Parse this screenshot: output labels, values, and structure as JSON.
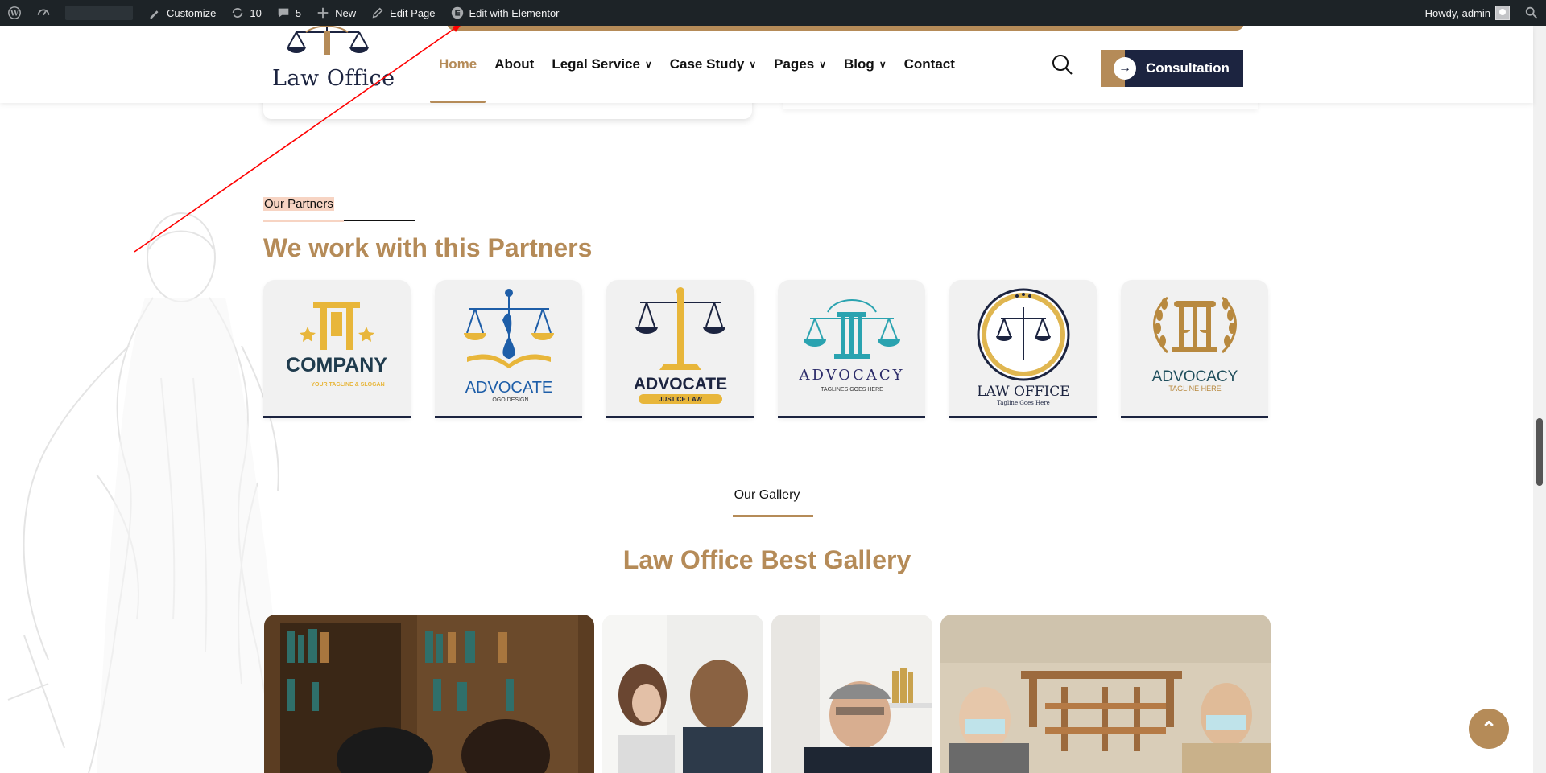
{
  "admin_bar": {
    "customize": "Customize",
    "updates_count": "10",
    "comments_count": "5",
    "new": "New",
    "edit_page": "Edit Page",
    "edit_elementor": "Edit with Elementor",
    "howdy": "Howdy, admin"
  },
  "header": {
    "logo_text": "Law Office",
    "nav": [
      {
        "label": "Home",
        "active": true
      },
      {
        "label": "About"
      },
      {
        "label": "Legal Service",
        "dropdown": true
      },
      {
        "label": "Case Study",
        "dropdown": true
      },
      {
        "label": "Pages",
        "dropdown": true
      },
      {
        "label": "Blog",
        "dropdown": true
      },
      {
        "label": "Contact"
      }
    ],
    "consultation": "Consultation"
  },
  "partners": {
    "label": "Our Partners",
    "title": "We work with this Partners",
    "logos": [
      {
        "name": "COMPANY",
        "tagline": "YOUR TAGLINE & SLOGAN"
      },
      {
        "name": "ADVOCATE",
        "tagline": "LOGO DESIGN"
      },
      {
        "name": "ADVOCATE",
        "tagline": "JUSTICE LAW"
      },
      {
        "name": "ADVOCACY",
        "tagline": "TAGLINES GOES HERE"
      },
      {
        "name": "LAW OFFICE",
        "tagline": "Tagline Goes Here"
      },
      {
        "name": "ADVOCACY",
        "tagline": "TAGLINE HERE"
      }
    ]
  },
  "gallery": {
    "label": "Our Gallery",
    "title": "Law Office Best Gallery"
  },
  "colors": {
    "accent": "#b58b58",
    "navy": "#1c2440",
    "adminbar": "#1d2327"
  }
}
